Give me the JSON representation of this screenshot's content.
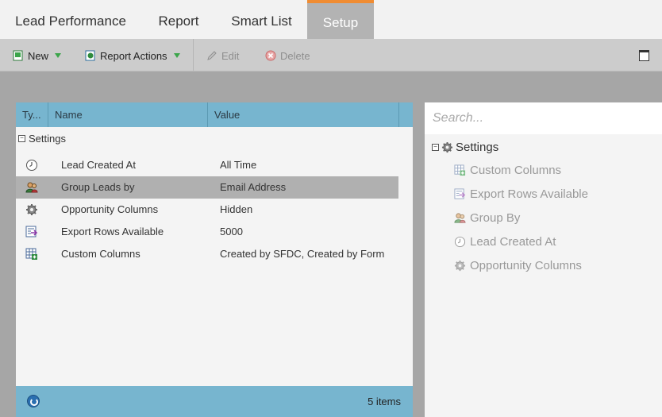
{
  "tabs": [
    {
      "label": "Lead Performance"
    },
    {
      "label": "Report"
    },
    {
      "label": "Smart List"
    },
    {
      "label": "Setup"
    }
  ],
  "toolbar": {
    "new_label": "New",
    "report_actions_label": "Report Actions",
    "edit_label": "Edit",
    "delete_label": "Delete"
  },
  "grid": {
    "columns": [
      "Ty...",
      "Name",
      "Value"
    ],
    "group_label": "Settings",
    "rows": [
      {
        "name": "Lead Created At",
        "value": "All Time",
        "icon": "clock-icon"
      },
      {
        "name": "Group Leads by",
        "value": "Email Address",
        "icon": "users-icon",
        "selected": true
      },
      {
        "name": "Opportunity Columns",
        "value": "Hidden",
        "icon": "gear-icon"
      },
      {
        "name": "Export Rows Available",
        "value": "5000",
        "icon": "export-icon"
      },
      {
        "name": "Custom Columns",
        "value": "Created by SFDC, Created by Form",
        "icon": "add-columns-icon"
      }
    ],
    "footer_count": "5 items"
  },
  "search": {
    "placeholder": "Search..."
  },
  "tree": {
    "root_label": "Settings",
    "items": [
      {
        "label": "Custom Columns",
        "icon": "add-columns-icon"
      },
      {
        "label": "Export Rows Available",
        "icon": "export-icon"
      },
      {
        "label": "Group By",
        "icon": "users-icon"
      },
      {
        "label": "Lead Created At",
        "icon": "clock-icon"
      },
      {
        "label": "Opportunity Columns",
        "icon": "gear-icon"
      }
    ]
  },
  "colors": {
    "accent_tab": "#f08c32",
    "grid_header": "#77b5cf",
    "selected_row": "#b0b0b0"
  }
}
